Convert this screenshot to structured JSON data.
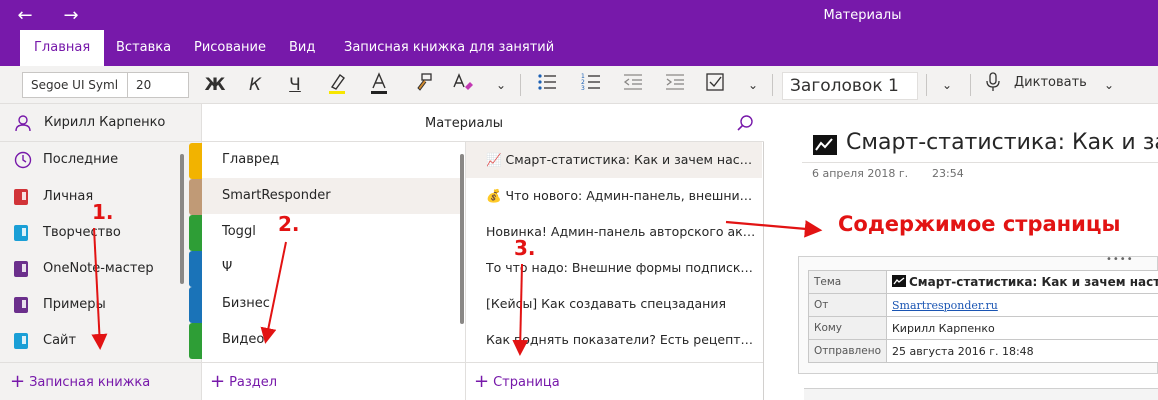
{
  "titlebar": {
    "title": "Материалы",
    "back_icon": "←",
    "forward_icon": "→",
    "color": "#7719aa"
  },
  "ribbon_tabs": [
    {
      "label": "Главная",
      "active": true
    },
    {
      "label": "Вставка",
      "active": false
    },
    {
      "label": "Рисование",
      "active": false
    },
    {
      "label": "Вид",
      "active": false
    },
    {
      "label": "Записная книжка для занятий",
      "active": false
    }
  ],
  "toolbar": {
    "font_name": "Segoe UI Symbol",
    "font_name_display": "Segoe UI Syml",
    "font_size": "20",
    "bold": "Ж",
    "italic": "К",
    "underline": "Ч",
    "style": "Заголовок 1",
    "dictate": "Диктовать",
    "icons": [
      "highlighter-icon",
      "font-color-icon",
      "format-painter-icon",
      "clear-format-icon",
      "bullet-list-icon",
      "numbered-list-icon",
      "outdent-icon",
      "indent-icon",
      "checkbox-icon",
      "more-icon",
      "style-dropdown-icon",
      "microphone-icon",
      "dictate-dropdown-icon"
    ]
  },
  "notebooks": {
    "user": "Кирилл Карпенко",
    "recent": "Последние",
    "items": [
      {
        "label": "Личная",
        "color": "#d13438"
      },
      {
        "label": "Творчество",
        "color": "#1a9fd6"
      },
      {
        "label": "OneNote-мастер",
        "color": "#6b2f8c"
      },
      {
        "label": "Примеры",
        "color": "#6b2f8c"
      },
      {
        "label": "Сайт",
        "color": "#1a9fd6"
      }
    ],
    "add": "Записная книжка"
  },
  "sections": {
    "title": "Материалы",
    "items": [
      {
        "label": "Главред",
        "color": "#f2b300",
        "selected": false
      },
      {
        "label": "SmartResponder",
        "color": "#c09a76",
        "selected": true
      },
      {
        "label": "Toggl",
        "color": "#2e9e36",
        "selected": false
      },
      {
        "label": "Ψ",
        "color": "#1a73b8",
        "selected": false
      },
      {
        "label": "Бизнес",
        "color": "#1a73b8",
        "selected": false
      },
      {
        "label": "Видео",
        "color": "#2e9e36",
        "selected": false
      }
    ],
    "add": "Раздел"
  },
  "pages": {
    "items": [
      {
        "label": "📈 Смарт-статистика: Как и зачем настраивать",
        "selected": true
      },
      {
        "label": "💰 Что нового: Админ-панель, внешние формы",
        "selected": false
      },
      {
        "label": "Новинка! Админ-панель авторского аккаунта",
        "selected": false
      },
      {
        "label": "То что надо: Внешние формы подписки на",
        "selected": false
      },
      {
        "label": "[Кейсы] Как создавать спецзадания",
        "selected": false
      },
      {
        "label": "Как поднять показатели? Есть рецепты! [С",
        "selected": false
      }
    ],
    "add": "Страница"
  },
  "content": {
    "title": "Смарт-статистика: Как и заче",
    "title_icon": "chart-icon",
    "date": "6 апреля 2018 г.",
    "time": "23:54",
    "email": {
      "rows": [
        {
          "key": "Тема",
          "value": "Смарт-статистика: Как и зачем настраива"
        },
        {
          "key": "От",
          "value": "Smartresponder.ru"
        },
        {
          "key": "Кому",
          "value": "Кирилл Карпенко"
        },
        {
          "key": "Отправлено",
          "value": "25 августа 2016 г. 18:48"
        }
      ]
    }
  },
  "annotations": {
    "label_1": "1.",
    "label_2": "2.",
    "label_3": "3.",
    "content_label": "Содержимое страницы",
    "color": "#e21313"
  }
}
